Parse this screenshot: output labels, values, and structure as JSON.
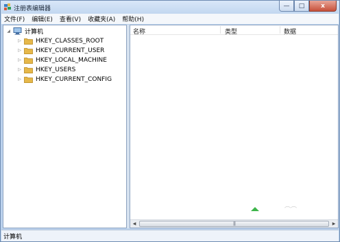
{
  "window": {
    "title": "注册表编辑器",
    "controls": {
      "minimize": "—",
      "maximize": "□",
      "close": "x"
    }
  },
  "menu": [
    "文件(F)",
    "编辑(E)",
    "查看(V)",
    "收藏夹(A)",
    "帮助(H)"
  ],
  "tree": {
    "root": {
      "label": "计算机",
      "expanded": true
    },
    "children": [
      {
        "label": "HKEY_CLASSES_ROOT"
      },
      {
        "label": "HKEY_CURRENT_USER"
      },
      {
        "label": "HKEY_LOCAL_MACHINE"
      },
      {
        "label": "HKEY_USERS"
      },
      {
        "label": "HKEY_CURRENT_CONFIG"
      }
    ]
  },
  "list": {
    "columns": [
      "名称",
      "类型",
      "数据"
    ]
  },
  "scrollbar": {
    "thumb_grip": "|||"
  },
  "status": {
    "path": "计算机"
  },
  "colors": {
    "folder": "#e6b84a",
    "accent_green": "#3db54a",
    "title_bar": "#c2d7f0"
  }
}
